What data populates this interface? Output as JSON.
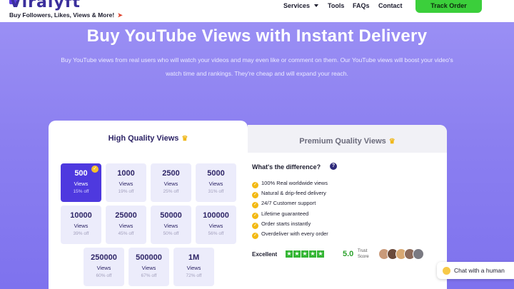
{
  "header": {
    "logo_text": "Viralyft",
    "tagline": "Buy Followers, Likes, Views & More!",
    "tagline_icon": "rocket-icon",
    "nav": [
      {
        "label": "Services",
        "has_dropdown": true
      },
      {
        "label": "Tools"
      },
      {
        "label": "FAQs"
      },
      {
        "label": "Contact"
      }
    ],
    "cta_label": "Track Order",
    "cta_color": "#3bcf3b"
  },
  "hero": {
    "title": "Buy YouTube Views with Instant Delivery",
    "description": "Buy YouTube views from real users who will watch your videos and may even like or comment on them. Our YouTube views will boost your video's watch time and rankings. They're cheap and will expand your reach."
  },
  "tabs": {
    "active": "High Quality Views",
    "inactive": "Premium Quality Views"
  },
  "packages": [
    {
      "qty": "500",
      "unit": "Views",
      "off": "15% off",
      "selected": true
    },
    {
      "qty": "1000",
      "unit": "Views",
      "off": "19% off"
    },
    {
      "qty": "2500",
      "unit": "Views",
      "off": "25% off"
    },
    {
      "qty": "5000",
      "unit": "Views",
      "off": "31% off"
    },
    {
      "qty": "10000",
      "unit": "Views",
      "off": "39% off"
    },
    {
      "qty": "25000",
      "unit": "Views",
      "off": "45% off"
    },
    {
      "qty": "50000",
      "unit": "Views",
      "off": "50% off"
    },
    {
      "qty": "100000",
      "unit": "Views",
      "off": "56% off"
    },
    {
      "qty": "250000",
      "unit": "Views",
      "off": "60% off"
    },
    {
      "qty": "500000",
      "unit": "Views",
      "off": "67% off"
    },
    {
      "qty": "1M",
      "unit": "Views",
      "off": "72% off"
    }
  ],
  "difference": {
    "title": "What's the difference?",
    "features": [
      "100% Real worldwide views",
      "Natural & drip-feed delivery",
      "24/7 Customer support",
      "Lifetime guaranteed",
      "Order starts instantly",
      "Overdeliver with every order"
    ]
  },
  "rating": {
    "label": "Excellent",
    "stars": 5,
    "score": "5.0",
    "trust_line1": "Trust",
    "trust_line2": "Score",
    "star_color": "#34b534"
  },
  "chat": {
    "label": "Chat with a human"
  },
  "colors": {
    "accent": "#4e39df",
    "hero_bg": "#8b7ff0"
  }
}
